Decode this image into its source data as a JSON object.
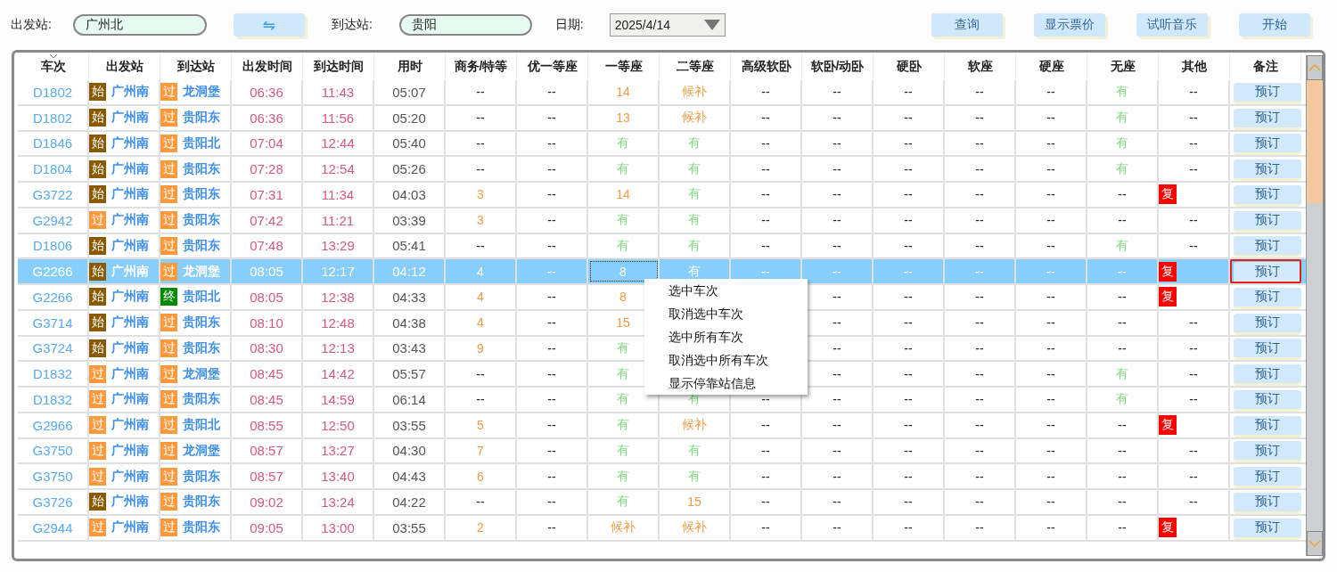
{
  "search": {
    "from_label": "出发站:",
    "from_value": "广州北",
    "swap": "⇋",
    "to_label": "到达站:",
    "to_value": "贵阳",
    "date_label": "日期:",
    "date_value": "2025/4/14"
  },
  "buttons": [
    "查询",
    "显示票价",
    "试听音乐",
    "开始"
  ],
  "table": {
    "columns": [
      "车次",
      "出发站",
      "到达站",
      "出发时间",
      "到达时间",
      "用时",
      "商务/特等",
      "优一等座",
      "一等座",
      "二等座",
      "高级软卧",
      "软卧/动卧",
      "硬卧",
      "软座",
      "硬座",
      "无座",
      "其他",
      "备注"
    ],
    "rows": [
      {
        "train": "D1802",
        "from_tag": {
          "text": "始",
          "color": "#8b5a00"
        },
        "from": "广州南",
        "to_tag": {
          "text": "过",
          "color": "#ff9a3c"
        },
        "to": "龙洞堡",
        "depart": "06:36",
        "arrive": "11:43",
        "duration": "05:07",
        "seats": {
          "business": {
            "value": "--",
            "kind": "none"
          },
          "premium_first": {
            "value": "--",
            "kind": "none"
          },
          "first": {
            "value": "14",
            "kind": "count"
          },
          "second": {
            "value": "候补",
            "kind": "waitlist"
          },
          "deluxe_soft_sleeper": {
            "value": "--",
            "kind": "none"
          },
          "soft_sleeper": {
            "value": "--",
            "kind": "none"
          },
          "hard_sleeper": {
            "value": "--",
            "kind": "none"
          },
          "soft_seat": {
            "value": "--",
            "kind": "none"
          },
          "hard_seat": {
            "value": "--",
            "kind": "none"
          },
          "no_seat": {
            "value": "有",
            "kind": "available"
          },
          "other": {
            "value": "--",
            "kind": "none"
          }
        },
        "note": "预订",
        "selected": false
      },
      {
        "train": "D1802",
        "from_tag": {
          "text": "始",
          "color": "#8b5a00"
        },
        "from": "广州南",
        "to_tag": {
          "text": "过",
          "color": "#ff9a3c"
        },
        "to": "贵阳东",
        "depart": "06:36",
        "arrive": "11:56",
        "duration": "05:20",
        "seats": {
          "business": {
            "value": "--",
            "kind": "none"
          },
          "premium_first": {
            "value": "--",
            "kind": "none"
          },
          "first": {
            "value": "13",
            "kind": "count"
          },
          "second": {
            "value": "候补",
            "kind": "waitlist"
          },
          "deluxe_soft_sleeper": {
            "value": "--",
            "kind": "none"
          },
          "soft_sleeper": {
            "value": "--",
            "kind": "none"
          },
          "hard_sleeper": {
            "value": "--",
            "kind": "none"
          },
          "soft_seat": {
            "value": "--",
            "kind": "none"
          },
          "hard_seat": {
            "value": "--",
            "kind": "none"
          },
          "no_seat": {
            "value": "有",
            "kind": "available"
          },
          "other": {
            "value": "--",
            "kind": "none"
          }
        },
        "note": "预订",
        "selected": false
      },
      {
        "train": "D1846",
        "from_tag": {
          "text": "始",
          "color": "#8b5a00"
        },
        "from": "广州南",
        "to_tag": {
          "text": "过",
          "color": "#ff9a3c"
        },
        "to": "贵阳北",
        "depart": "07:04",
        "arrive": "12:44",
        "duration": "05:40",
        "seats": {
          "business": {
            "value": "--",
            "kind": "none"
          },
          "premium_first": {
            "value": "--",
            "kind": "none"
          },
          "first": {
            "value": "有",
            "kind": "available"
          },
          "second": {
            "value": "有",
            "kind": "available"
          },
          "deluxe_soft_sleeper": {
            "value": "--",
            "kind": "none"
          },
          "soft_sleeper": {
            "value": "--",
            "kind": "none"
          },
          "hard_sleeper": {
            "value": "--",
            "kind": "none"
          },
          "soft_seat": {
            "value": "--",
            "kind": "none"
          },
          "hard_seat": {
            "value": "--",
            "kind": "none"
          },
          "no_seat": {
            "value": "有",
            "kind": "available"
          },
          "other": {
            "value": "--",
            "kind": "none"
          }
        },
        "note": "预订",
        "selected": false
      },
      {
        "train": "D1804",
        "from_tag": {
          "text": "始",
          "color": "#8b5a00"
        },
        "from": "广州南",
        "to_tag": {
          "text": "过",
          "color": "#ff9a3c"
        },
        "to": "贵阳东",
        "depart": "07:28",
        "arrive": "12:54",
        "duration": "05:26",
        "seats": {
          "business": {
            "value": "--",
            "kind": "none"
          },
          "premium_first": {
            "value": "--",
            "kind": "none"
          },
          "first": {
            "value": "有",
            "kind": "available"
          },
          "second": {
            "value": "有",
            "kind": "available"
          },
          "deluxe_soft_sleeper": {
            "value": "--",
            "kind": "none"
          },
          "soft_sleeper": {
            "value": "--",
            "kind": "none"
          },
          "hard_sleeper": {
            "value": "--",
            "kind": "none"
          },
          "soft_seat": {
            "value": "--",
            "kind": "none"
          },
          "hard_seat": {
            "value": "--",
            "kind": "none"
          },
          "no_seat": {
            "value": "有",
            "kind": "available"
          },
          "other": {
            "value": "--",
            "kind": "none"
          }
        },
        "note": "预订",
        "selected": false
      },
      {
        "train": "G3722",
        "from_tag": {
          "text": "始",
          "color": "#8b5a00"
        },
        "from": "广州南",
        "to_tag": {
          "text": "过",
          "color": "#ff9a3c"
        },
        "to": "贵阳东",
        "depart": "07:31",
        "arrive": "11:34",
        "duration": "04:03",
        "seats": {
          "business": {
            "value": "3",
            "kind": "count"
          },
          "premium_first": {
            "value": "--",
            "kind": "none"
          },
          "first": {
            "value": "14",
            "kind": "count"
          },
          "second": {
            "value": "有",
            "kind": "available"
          },
          "deluxe_soft_sleeper": {
            "value": "--",
            "kind": "none"
          },
          "soft_sleeper": {
            "value": "--",
            "kind": "none"
          },
          "hard_sleeper": {
            "value": "--",
            "kind": "none"
          },
          "soft_seat": {
            "value": "--",
            "kind": "none"
          },
          "hard_seat": {
            "value": "--",
            "kind": "none"
          },
          "no_seat": {
            "value": "--",
            "kind": "none"
          },
          "other": {
            "value": "复",
            "kind": "badge"
          }
        },
        "note": "预订",
        "selected": false
      },
      {
        "train": "G2942",
        "from_tag": {
          "text": "过",
          "color": "#ff9a3c"
        },
        "from": "广州南",
        "to_tag": {
          "text": "过",
          "color": "#ff9a3c"
        },
        "to": "贵阳东",
        "depart": "07:42",
        "arrive": "11:21",
        "duration": "03:39",
        "seats": {
          "business": {
            "value": "3",
            "kind": "count"
          },
          "premium_first": {
            "value": "--",
            "kind": "none"
          },
          "first": {
            "value": "有",
            "kind": "available"
          },
          "second": {
            "value": "有",
            "kind": "available"
          },
          "deluxe_soft_sleeper": {
            "value": "--",
            "kind": "none"
          },
          "soft_sleeper": {
            "value": "--",
            "kind": "none"
          },
          "hard_sleeper": {
            "value": "--",
            "kind": "none"
          },
          "soft_seat": {
            "value": "--",
            "kind": "none"
          },
          "hard_seat": {
            "value": "--",
            "kind": "none"
          },
          "no_seat": {
            "value": "--",
            "kind": "none"
          },
          "other": {
            "value": "--",
            "kind": "none"
          }
        },
        "note": "预订",
        "selected": false
      },
      {
        "train": "D1806",
        "from_tag": {
          "text": "始",
          "color": "#8b5a00"
        },
        "from": "广州南",
        "to_tag": {
          "text": "过",
          "color": "#ff9a3c"
        },
        "to": "贵阳东",
        "depart": "07:48",
        "arrive": "13:29",
        "duration": "05:41",
        "seats": {
          "business": {
            "value": "--",
            "kind": "none"
          },
          "premium_first": {
            "value": "--",
            "kind": "none"
          },
          "first": {
            "value": "有",
            "kind": "available"
          },
          "second": {
            "value": "有",
            "kind": "available"
          },
          "deluxe_soft_sleeper": {
            "value": "--",
            "kind": "none"
          },
          "soft_sleeper": {
            "value": "--",
            "kind": "none"
          },
          "hard_sleeper": {
            "value": "--",
            "kind": "none"
          },
          "soft_seat": {
            "value": "--",
            "kind": "none"
          },
          "hard_seat": {
            "value": "--",
            "kind": "none"
          },
          "no_seat": {
            "value": "有",
            "kind": "available"
          },
          "other": {
            "value": "--",
            "kind": "none"
          }
        },
        "note": "预订",
        "selected": false
      },
      {
        "train": "G2266",
        "from_tag": {
          "text": "始",
          "color": "#8b5a00"
        },
        "from": "广州南",
        "to_tag": {
          "text": "过",
          "color": "#ff9a3c"
        },
        "to": "龙洞堡",
        "depart": "08:05",
        "arrive": "12:17",
        "duration": "04:12",
        "seats": {
          "business": {
            "value": "4",
            "kind": "count"
          },
          "premium_first": {
            "value": "--",
            "kind": "none"
          },
          "first": {
            "value": "8",
            "kind": "count"
          },
          "second": {
            "value": "有",
            "kind": "available"
          },
          "deluxe_soft_sleeper": {
            "value": "--",
            "kind": "none"
          },
          "soft_sleeper": {
            "value": "--",
            "kind": "none"
          },
          "hard_sleeper": {
            "value": "--",
            "kind": "none"
          },
          "soft_seat": {
            "value": "--",
            "kind": "none"
          },
          "hard_seat": {
            "value": "--",
            "kind": "none"
          },
          "no_seat": {
            "value": "--",
            "kind": "none"
          },
          "other": {
            "value": "复",
            "kind": "badge"
          }
        },
        "note": "预订",
        "selected": true
      },
      {
        "train": "G2266",
        "from_tag": {
          "text": "始",
          "color": "#8b5a00"
        },
        "from": "广州南",
        "to_tag": {
          "text": "终",
          "color": "#008a00"
        },
        "to": "贵阳北",
        "depart": "08:05",
        "arrive": "12:38",
        "duration": "04:33",
        "seats": {
          "business": {
            "value": "4",
            "kind": "count"
          },
          "premium_first": {
            "value": "--",
            "kind": "none"
          },
          "first": {
            "value": "8",
            "kind": "count"
          },
          "soft_sleeper": {
            "value": "--",
            "kind": "none"
          },
          "hard_sleeper": {
            "value": "--",
            "kind": "none"
          },
          "soft_seat": {
            "value": "--",
            "kind": "none"
          },
          "hard_seat": {
            "value": "--",
            "kind": "none"
          },
          "no_seat": {
            "value": "--",
            "kind": "none"
          },
          "other": {
            "value": "复",
            "kind": "badge"
          }
        },
        "note": "预订",
        "selected": false
      },
      {
        "train": "G3714",
        "from_tag": {
          "text": "始",
          "color": "#8b5a00"
        },
        "from": "广州南",
        "to_tag": {
          "text": "过",
          "color": "#ff9a3c"
        },
        "to": "贵阳东",
        "depart": "08:10",
        "arrive": "12:48",
        "duration": "04:38",
        "seats": {
          "business": {
            "value": "4",
            "kind": "count"
          },
          "premium_first": {
            "value": "--",
            "kind": "none"
          },
          "first": {
            "value": "15",
            "kind": "count"
          },
          "soft_sleeper": {
            "value": "--",
            "kind": "none"
          },
          "hard_sleeper": {
            "value": "--",
            "kind": "none"
          },
          "soft_seat": {
            "value": "--",
            "kind": "none"
          },
          "hard_seat": {
            "value": "--",
            "kind": "none"
          },
          "no_seat": {
            "value": "--",
            "kind": "none"
          },
          "other": {
            "value": "--",
            "kind": "none"
          }
        },
        "note": "预订",
        "selected": false
      },
      {
        "train": "G3724",
        "from_tag": {
          "text": "始",
          "color": "#8b5a00"
        },
        "from": "广州南",
        "to_tag": {
          "text": "过",
          "color": "#ff9a3c"
        },
        "to": "贵阳东",
        "depart": "08:30",
        "arrive": "12:13",
        "duration": "03:43",
        "seats": {
          "business": {
            "value": "9",
            "kind": "count"
          },
          "premium_first": {
            "value": "--",
            "kind": "none"
          },
          "first": {
            "value": "有",
            "kind": "available"
          },
          "soft_sleeper": {
            "value": "--",
            "kind": "none"
          },
          "hard_sleeper": {
            "value": "--",
            "kind": "none"
          },
          "soft_seat": {
            "value": "--",
            "kind": "none"
          },
          "hard_seat": {
            "value": "--",
            "kind": "none"
          },
          "no_seat": {
            "value": "--",
            "kind": "none"
          },
          "other": {
            "value": "--",
            "kind": "none"
          }
        },
        "note": "预订",
        "selected": false
      },
      {
        "train": "D1832",
        "from_tag": {
          "text": "过",
          "color": "#ff9a3c"
        },
        "from": "广州南",
        "to_tag": {
          "text": "过",
          "color": "#ff9a3c"
        },
        "to": "龙洞堡",
        "depart": "08:45",
        "arrive": "14:42",
        "duration": "05:57",
        "seats": {
          "business": {
            "value": "--",
            "kind": "none"
          },
          "premium_first": {
            "value": "--",
            "kind": "none"
          },
          "first": {
            "value": "有",
            "kind": "available"
          },
          "soft_sleeper": {
            "value": "--",
            "kind": "none"
          },
          "hard_sleeper": {
            "value": "--",
            "kind": "none"
          },
          "soft_seat": {
            "value": "--",
            "kind": "none"
          },
          "hard_seat": {
            "value": "--",
            "kind": "none"
          },
          "no_seat": {
            "value": "有",
            "kind": "available"
          },
          "other": {
            "value": "--",
            "kind": "none"
          }
        },
        "note": "预订",
        "selected": false
      },
      {
        "train": "D1832",
        "from_tag": {
          "text": "过",
          "color": "#ff9a3c"
        },
        "from": "广州南",
        "to_tag": {
          "text": "过",
          "color": "#ff9a3c"
        },
        "to": "贵阳东",
        "depart": "08:45",
        "arrive": "14:59",
        "duration": "06:14",
        "seats": {
          "business": {
            "value": "--",
            "kind": "none"
          },
          "premium_first": {
            "value": "--",
            "kind": "none"
          },
          "first": {
            "value": "有",
            "kind": "available"
          },
          "second": {
            "value": "有",
            "kind": "available"
          },
          "deluxe_soft_sleeper": {
            "value": "--",
            "kind": "none"
          },
          "soft_sleeper": {
            "value": "--",
            "kind": "none"
          },
          "hard_sleeper": {
            "value": "--",
            "kind": "none"
          },
          "soft_seat": {
            "value": "--",
            "kind": "none"
          },
          "hard_seat": {
            "value": "--",
            "kind": "none"
          },
          "no_seat": {
            "value": "有",
            "kind": "available"
          },
          "other": {
            "value": "--",
            "kind": "none"
          }
        },
        "note": "预订",
        "selected": false
      },
      {
        "train": "G2966",
        "from_tag": {
          "text": "过",
          "color": "#ff9a3c"
        },
        "from": "广州南",
        "to_tag": {
          "text": "过",
          "color": "#ff9a3c"
        },
        "to": "贵阳北",
        "depart": "08:55",
        "arrive": "12:50",
        "duration": "03:55",
        "seats": {
          "business": {
            "value": "5",
            "kind": "count"
          },
          "premium_first": {
            "value": "--",
            "kind": "none"
          },
          "first": {
            "value": "有",
            "kind": "available"
          },
          "second": {
            "value": "候补",
            "kind": "waitlist"
          },
          "deluxe_soft_sleeper": {
            "value": "--",
            "kind": "none"
          },
          "soft_sleeper": {
            "value": "--",
            "kind": "none"
          },
          "hard_sleeper": {
            "value": "--",
            "kind": "none"
          },
          "soft_seat": {
            "value": "--",
            "kind": "none"
          },
          "hard_seat": {
            "value": "--",
            "kind": "none"
          },
          "no_seat": {
            "value": "--",
            "kind": "none"
          },
          "other": {
            "value": "复",
            "kind": "badge"
          }
        },
        "note": "预订",
        "selected": false
      },
      {
        "train": "G3750",
        "from_tag": {
          "text": "过",
          "color": "#ff9a3c"
        },
        "from": "广州南",
        "to_tag": {
          "text": "过",
          "color": "#ff9a3c"
        },
        "to": "龙洞堡",
        "depart": "08:57",
        "arrive": "13:27",
        "duration": "04:30",
        "seats": {
          "business": {
            "value": "7",
            "kind": "count"
          },
          "premium_first": {
            "value": "--",
            "kind": "none"
          },
          "first": {
            "value": "有",
            "kind": "available"
          },
          "second": {
            "value": "有",
            "kind": "available"
          },
          "deluxe_soft_sleeper": {
            "value": "--",
            "kind": "none"
          },
          "soft_sleeper": {
            "value": "--",
            "kind": "none"
          },
          "hard_sleeper": {
            "value": "--",
            "kind": "none"
          },
          "soft_seat": {
            "value": "--",
            "kind": "none"
          },
          "hard_seat": {
            "value": "--",
            "kind": "none"
          },
          "no_seat": {
            "value": "--",
            "kind": "none"
          },
          "other": {
            "value": "--",
            "kind": "none"
          }
        },
        "note": "预订",
        "selected": false
      },
      {
        "train": "G3750",
        "from_tag": {
          "text": "过",
          "color": "#ff9a3c"
        },
        "from": "广州南",
        "to_tag": {
          "text": "过",
          "color": "#ff9a3c"
        },
        "to": "贵阳东",
        "depart": "08:57",
        "arrive": "13:40",
        "duration": "04:43",
        "seats": {
          "business": {
            "value": "6",
            "kind": "count"
          },
          "premium_first": {
            "value": "--",
            "kind": "none"
          },
          "first": {
            "value": "有",
            "kind": "available"
          },
          "second": {
            "value": "有",
            "kind": "available"
          },
          "deluxe_soft_sleeper": {
            "value": "--",
            "kind": "none"
          },
          "soft_sleeper": {
            "value": "--",
            "kind": "none"
          },
          "hard_sleeper": {
            "value": "--",
            "kind": "none"
          },
          "soft_seat": {
            "value": "--",
            "kind": "none"
          },
          "hard_seat": {
            "value": "--",
            "kind": "none"
          },
          "no_seat": {
            "value": "--",
            "kind": "none"
          },
          "other": {
            "value": "--",
            "kind": "none"
          }
        },
        "note": "预订",
        "selected": false
      },
      {
        "train": "G3726",
        "from_tag": {
          "text": "始",
          "color": "#8b5a00"
        },
        "from": "广州南",
        "to_tag": {
          "text": "过",
          "color": "#ff9a3c"
        },
        "to": "贵阳东",
        "depart": "09:02",
        "arrive": "13:24",
        "duration": "04:22",
        "seats": {
          "business": {
            "value": "--",
            "kind": "none"
          },
          "premium_first": {
            "value": "--",
            "kind": "none"
          },
          "first": {
            "value": "有",
            "kind": "available"
          },
          "second": {
            "value": "15",
            "kind": "count"
          },
          "deluxe_soft_sleeper": {
            "value": "--",
            "kind": "none"
          },
          "soft_sleeper": {
            "value": "--",
            "kind": "none"
          },
          "hard_sleeper": {
            "value": "--",
            "kind": "none"
          },
          "soft_seat": {
            "value": "--",
            "kind": "none"
          },
          "hard_seat": {
            "value": "--",
            "kind": "none"
          },
          "no_seat": {
            "value": "--",
            "kind": "none"
          },
          "other": {
            "value": "--",
            "kind": "none"
          }
        },
        "note": "预订",
        "selected": false
      },
      {
        "train": "G2944",
        "from_tag": {
          "text": "过",
          "color": "#ff9a3c"
        },
        "from": "广州南",
        "to_tag": {
          "text": "过",
          "color": "#ff9a3c"
        },
        "to": "贵阳东",
        "depart": "09:05",
        "arrive": "13:00",
        "duration": "03:55",
        "seats": {
          "business": {
            "value": "2",
            "kind": "count"
          },
          "premium_first": {
            "value": "--",
            "kind": "none"
          },
          "first": {
            "value": "候补",
            "kind": "waitlist"
          },
          "second": {
            "value": "候补",
            "kind": "waitlist"
          },
          "deluxe_soft_sleeper": {
            "value": "--",
            "kind": "none"
          },
          "soft_sleeper": {
            "value": "--",
            "kind": "none"
          },
          "hard_sleeper": {
            "value": "--",
            "kind": "none"
          },
          "soft_seat": {
            "value": "--",
            "kind": "none"
          },
          "hard_seat": {
            "value": "--",
            "kind": "none"
          },
          "no_seat": {
            "value": "--",
            "kind": "none"
          },
          "other": {
            "value": "复",
            "kind": "badge"
          }
        },
        "note": "预订",
        "selected": false
      }
    ]
  },
  "context_menu": [
    "选中车次",
    "取消选中车次",
    "选中所有车次",
    "取消选中所有车次",
    "显示停靠站信息"
  ]
}
